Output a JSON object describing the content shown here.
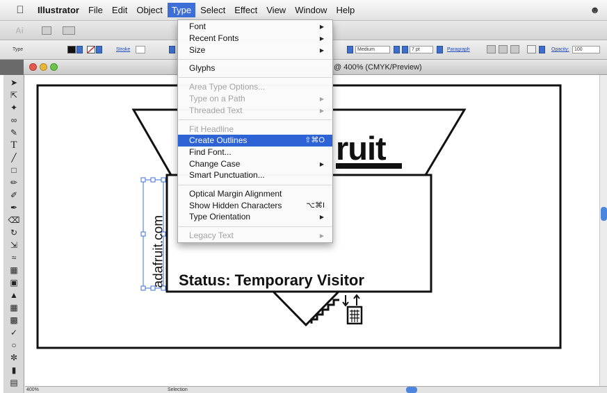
{
  "menubar": {
    "app_name": "Illustrator",
    "items": [
      "File",
      "Edit",
      "Object",
      "Type",
      "Select",
      "Effect",
      "View",
      "Window",
      "Help"
    ],
    "active_item": "Type"
  },
  "appbar": {
    "logo": "Ai"
  },
  "control_bar": {
    "type_label": "Type",
    "stroke_label": "Stroke",
    "font_style": "Medium",
    "font_size": "7 pt",
    "paragraph_label": "Paragraph",
    "opacity_label": "Opacity:",
    "opacity_value": "100"
  },
  "document": {
    "title": "@ 400% (CMYK/Preview)"
  },
  "artwork": {
    "logo_text": "ruit",
    "status_text": "Status: Temporary Visitor",
    "vertical_text": "adafruit.com"
  },
  "type_menu": {
    "items": [
      {
        "label": "Font",
        "submenu": true,
        "disabled": false
      },
      {
        "label": "Recent Fonts",
        "submenu": true,
        "disabled": false
      },
      {
        "label": "Size",
        "submenu": true,
        "disabled": false
      },
      {
        "label": "Glyphs",
        "submenu": false,
        "disabled": false
      },
      {
        "label": "Area Type Options...",
        "submenu": false,
        "disabled": true
      },
      {
        "label": "Type on a Path",
        "submenu": true,
        "disabled": true
      },
      {
        "label": "Threaded Text",
        "submenu": true,
        "disabled": true
      },
      {
        "label": "Fit Headline",
        "submenu": false,
        "disabled": true
      },
      {
        "label": "Create Outlines",
        "submenu": false,
        "disabled": false,
        "highlighted": true,
        "shortcut": "⇧⌘O"
      },
      {
        "label": "Find Font...",
        "submenu": false,
        "disabled": false
      },
      {
        "label": "Change Case",
        "submenu": true,
        "disabled": false
      },
      {
        "label": "Smart Punctuation...",
        "submenu": false,
        "disabled": false
      },
      {
        "label": "Optical Margin Alignment",
        "submenu": false,
        "disabled": false
      },
      {
        "label": "Show Hidden Characters",
        "submenu": false,
        "disabled": false,
        "shortcut": "⌥⌘I"
      },
      {
        "label": "Type Orientation",
        "submenu": true,
        "disabled": false
      },
      {
        "label": "Legacy Text",
        "submenu": true,
        "disabled": true
      }
    ]
  },
  "status_bar": {
    "zoom": "400%",
    "mode": "Selection"
  },
  "colors": {
    "menu_highlight": "#2e63d6",
    "scroll_knob": "#4b85de"
  }
}
